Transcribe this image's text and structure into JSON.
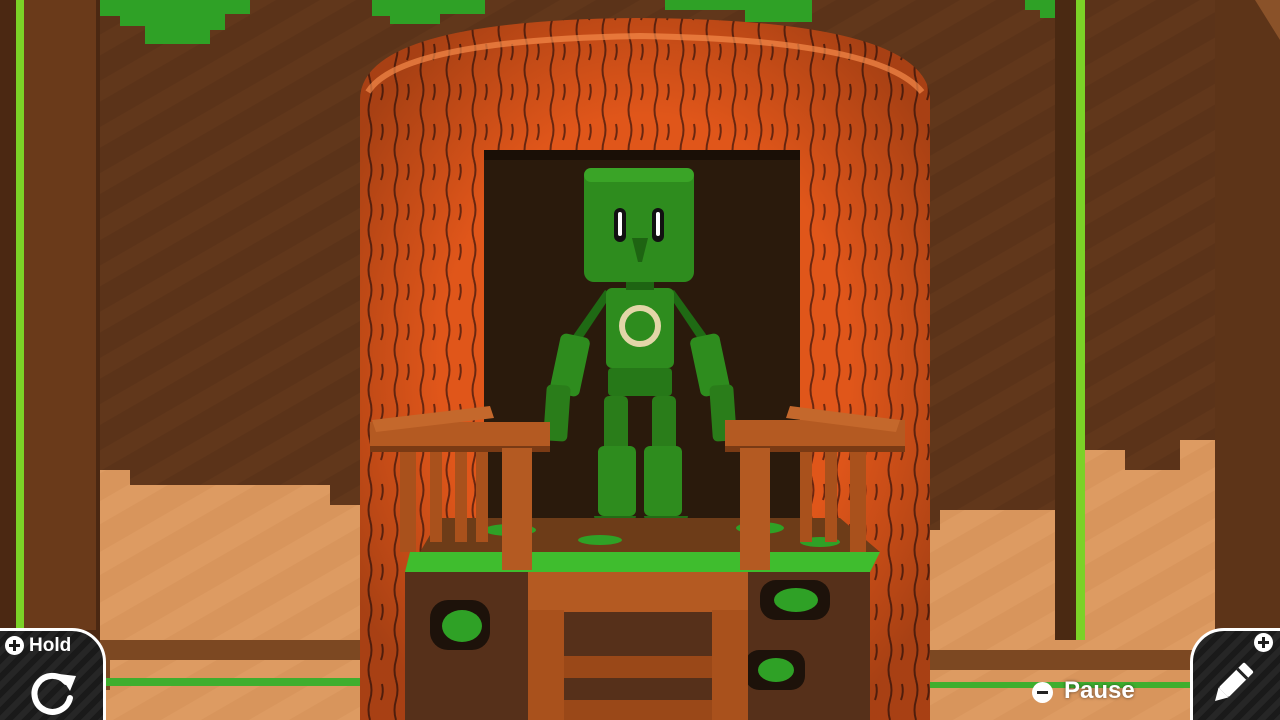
{
  "hud": {
    "hold": {
      "label": "Hold",
      "button_icon": "plus-button-icon",
      "action_icon": "rotate-icon"
    },
    "pause": {
      "label": "Pause",
      "button_icon": "minus-button-icon"
    },
    "edit": {
      "button_icon": "plus-button-icon",
      "action_icon": "pencil-icon"
    }
  },
  "scene": {
    "character": "green-robot",
    "emblem": "circle-icon",
    "colors": {
      "wall": "#5c3318",
      "floor": "#d8955c",
      "trunk": "#e85c18",
      "robot": "#2e8c1e",
      "leaf": "#39a827",
      "wood": "#a9511c"
    }
  }
}
